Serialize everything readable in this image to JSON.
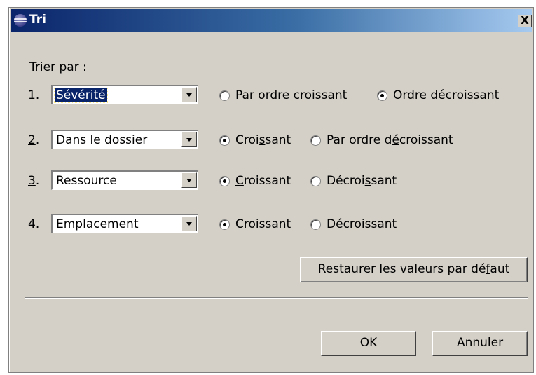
{
  "window": {
    "title": "Tri",
    "close_label": "X"
  },
  "form": {
    "sort_by_label": "Trier par :",
    "rows": [
      {
        "number_key": "1",
        "number_suffix": ".",
        "combo_value": "Sévérité",
        "combo_selected": true,
        "asc": {
          "pre": "Par ordre ",
          "key": "c",
          "post": "roissant",
          "checked": false
        },
        "desc": {
          "pre": "Or",
          "key": "d",
          "post": "re décroissant",
          "checked": true
        }
      },
      {
        "number_key": "2",
        "number_suffix": ".",
        "combo_value": "Dans le dossier",
        "combo_selected": false,
        "asc": {
          "pre": "Croi",
          "key": "s",
          "post": "sant",
          "checked": true
        },
        "desc": {
          "pre": "Par ordre d",
          "key": "é",
          "post": "croissant",
          "checked": false
        }
      },
      {
        "number_key": "3",
        "number_suffix": ".",
        "combo_value": "Ressource",
        "combo_selected": false,
        "asc": {
          "pre": "",
          "key": "C",
          "post": "roissant",
          "checked": true
        },
        "desc": {
          "pre": "Décroi",
          "key": "s",
          "post": "sant",
          "checked": false
        }
      },
      {
        "number_key": "4",
        "number_suffix": ".",
        "combo_value": "Emplacement",
        "combo_selected": false,
        "asc": {
          "pre": "Croissa",
          "key": "n",
          "post": "t",
          "checked": true
        },
        "desc": {
          "pre": "D",
          "key": "é",
          "post": "croissant",
          "checked": false
        }
      }
    ]
  },
  "restore_button": {
    "pre": "Restaurer les valeurs par dé",
    "key": "f",
    "post": "aut"
  },
  "ok_label": "OK",
  "cancel_label": "Annuler",
  "icons": {
    "window_icon": "eclipse-icon",
    "dropdown_icon": "chevron-down-icon",
    "close_icon": "close-icon"
  }
}
